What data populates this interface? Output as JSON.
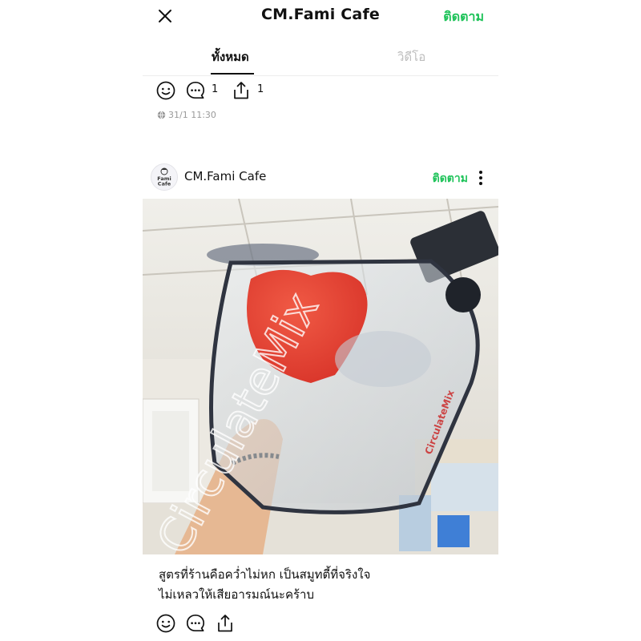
{
  "header": {
    "title": "CM.Fami Cafe",
    "follow_label": "ติดตาม"
  },
  "tabs": [
    {
      "label": "ทั้งหมด",
      "active": true
    },
    {
      "label": "วิดีโอ",
      "active": false
    }
  ],
  "prev_post": {
    "comment_count": "1",
    "share_count": "1",
    "timestamp": "31/1 11:30"
  },
  "post": {
    "author": "CM.Fami Cafe",
    "follow_label": "ติดตาม",
    "avatar_text": {
      "line1": "Fami",
      "line2": "Cafe"
    },
    "image_watermark": "CirculateMix",
    "jar_label": "CirculateMix",
    "caption_line1": "สูตรที่ร้านคือคว่ำไม่หก เป็นสมูทตี้ที่จริงใจ",
    "caption_line2": "ไม่เหลวให้เสียอารมณ์นะคร้าบ"
  },
  "colors": {
    "accent_green": "#1fc35a",
    "muted_text": "#9a9a9a",
    "inactive_tab": "#bdbdbd"
  },
  "icons": [
    "close-icon",
    "smiley-icon",
    "comment-icon",
    "share-icon",
    "globe-icon",
    "more-vertical-icon"
  ]
}
